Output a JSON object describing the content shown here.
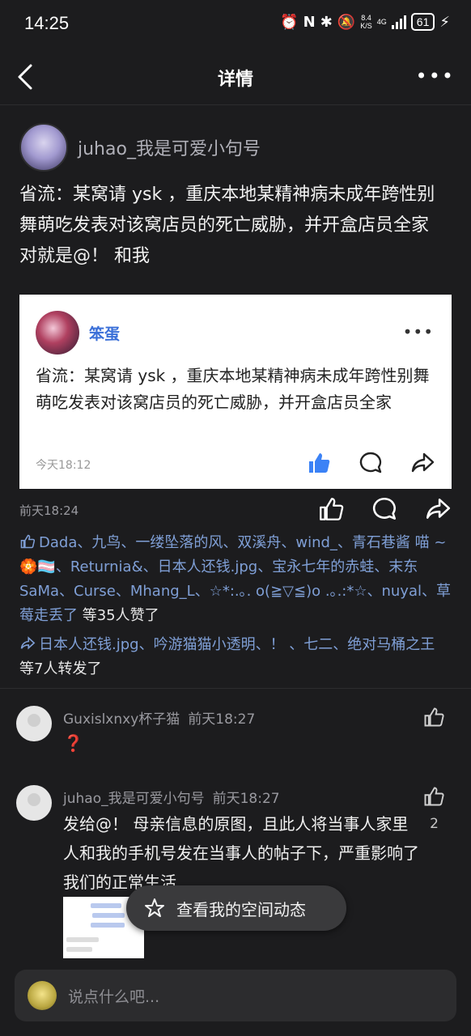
{
  "status_bar": {
    "time": "14:25",
    "net_speed_top": "8.4",
    "net_speed_bottom": "K/S",
    "network": "4G",
    "battery": "61"
  },
  "nav": {
    "title": "详情"
  },
  "post": {
    "author": "juhao_我是可爱小句号",
    "text_line1": "省流：某窝请 ysk ，重庆本地某精神病未成年跨性别舞萌吃发表对该窝店员的死亡威胁，并开盒店员全家",
    "text_line2": "对就是@！  和我",
    "time": "前天18:24"
  },
  "quote": {
    "author": "笨蛋",
    "text": "省流：某窝请 ysk ，重庆本地某精神病未成年跨性别舞萌吃发表对该窝店员的死亡威胁，并开盒店员全家",
    "time": "今天18:12"
  },
  "likes": {
    "names": "Dada、九鸟、一缕坠落的风、双溪舟、wind_、青石巷酱 喵 ~ 🏵️🏳️‍⚧️、Returnia&、日本人还钱.jpg、宝永七年的赤蛙、末东SaMa、Curse、Mhang_L、☆*:.｡. o(≧▽≦)o .｡.:*☆、nuyal、草莓走丢了",
    "tail": " 等35人赞了"
  },
  "shares": {
    "names": "日本人还钱.jpg、吟游猫猫小透明、！ 、七二、绝对马桶之王",
    "tail": " 等7人转发了"
  },
  "comments": [
    {
      "author": "Guxislxnxy杯子猫",
      "time": "前天18:27",
      "body": "❓",
      "likes": ""
    },
    {
      "author": "juhao_我是可爱小句号",
      "time": "前天18:27",
      "body": "发给@！  母亲信息的原图，且此人将当事人家里人和我的手机号发在当事人的帖子下，严重影响了我们的正常生活",
      "likes": "2"
    }
  ],
  "floating_button": {
    "label": "查看我的空间动态"
  },
  "comment_input": {
    "placeholder": "说点什么吧..."
  },
  "colors": {
    "background": "#1c1c1e",
    "link": "#7f9fd6",
    "quote_name": "#3a6fd8"
  }
}
